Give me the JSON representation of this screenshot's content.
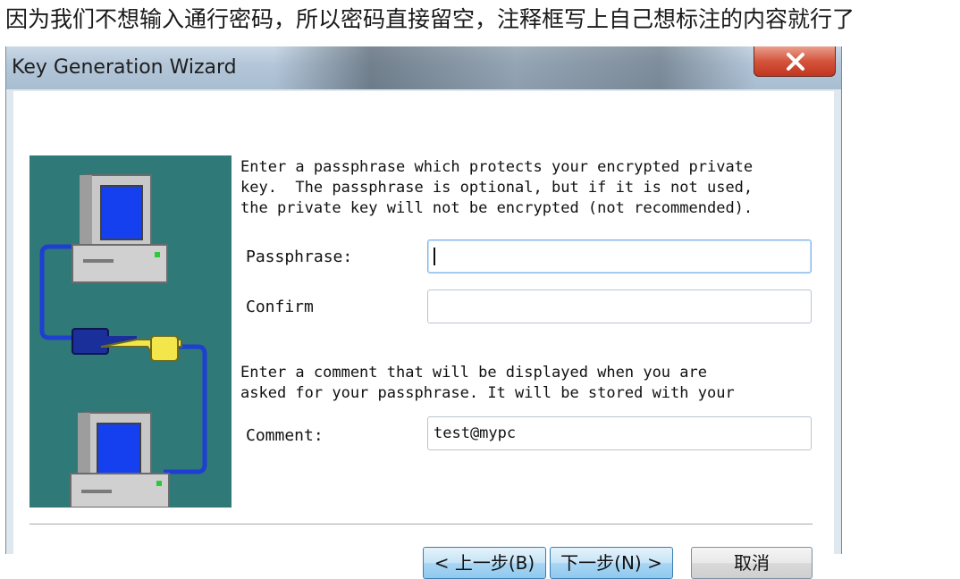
{
  "caption": "因为我们不想输入通行密码，所以密码直接留空，注释框写上自己想标注的内容就行了",
  "window": {
    "title": "Key Generation Wizard",
    "close_label": "x"
  },
  "intro_text": "Enter a passphrase which protects your encrypted private\nkey.  The passphrase is optional, but if it is not used,\nthe private key will not be encrypted (not recommended).",
  "passphrase": {
    "label": "Passphrase:",
    "value": ""
  },
  "confirm": {
    "label": "Confirm",
    "value": ""
  },
  "comment_text": "Enter a comment that will be displayed when you are\nasked for your passphrase. It will be stored with your",
  "comment": {
    "label": "Comment:",
    "value": "test@mypc"
  },
  "buttons": {
    "back": "< 上一步(B)",
    "next": "下一步(N) >",
    "cancel": "取消"
  },
  "colors": {
    "illustration_bg": "#2f7a78",
    "cable": "#1f3fd0",
    "screen": "#1440f0",
    "key_dark": "#1a2f9a",
    "key_light": "#f2e64a"
  },
  "illustration_icons": [
    "computer-top-icon",
    "key-icon",
    "computer-bottom-icon"
  ]
}
